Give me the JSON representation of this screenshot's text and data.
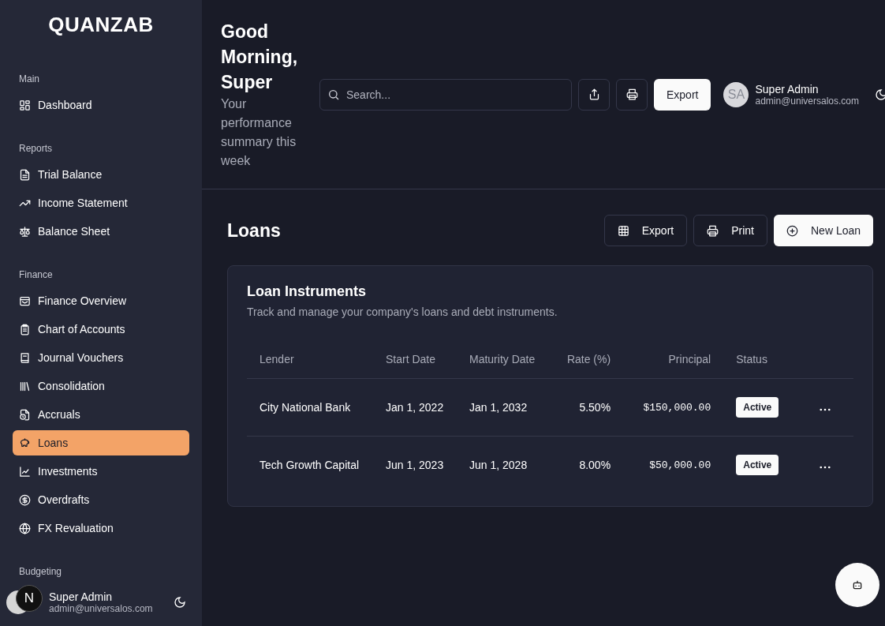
{
  "brand": "QUANZAB",
  "sidebar": {
    "sections": [
      {
        "label": "Main",
        "items": [
          {
            "label": "Dashboard",
            "selected": false
          }
        ]
      },
      {
        "label": "Reports",
        "items": [
          {
            "label": "Trial Balance",
            "selected": false
          },
          {
            "label": "Income Statement",
            "selected": false
          },
          {
            "label": "Balance Sheet",
            "selected": false
          }
        ]
      },
      {
        "label": "Finance",
        "items": [
          {
            "label": "Finance Overview",
            "selected": false
          },
          {
            "label": "Chart of Accounts",
            "selected": false
          },
          {
            "label": "Journal Vouchers",
            "selected": false
          },
          {
            "label": "Consolidation",
            "selected": false
          },
          {
            "label": "Accruals",
            "selected": false
          },
          {
            "label": "Loans",
            "selected": true
          },
          {
            "label": "Investments",
            "selected": false
          },
          {
            "label": "Overdrafts",
            "selected": false
          },
          {
            "label": "FX Revaluation",
            "selected": false
          }
        ]
      },
      {
        "label": "Budgeting"
      }
    ],
    "user": {
      "name": "Super Admin",
      "email": "admin@universalos.com"
    },
    "badge": "N"
  },
  "header": {
    "greeting": "Good Morning, Super",
    "subtitle": "Your performance summary this week",
    "search": {
      "placeholder": "Search..."
    },
    "export_button": "Export",
    "user": {
      "initials": "SA",
      "name": "Super Admin",
      "email": "admin@universalos.com"
    }
  },
  "page": {
    "title": "Loans",
    "actions": [
      {
        "label": "Export",
        "kind": "outline"
      },
      {
        "label": "Print",
        "kind": "outline"
      },
      {
        "label": "New Loan",
        "kind": "primary"
      }
    ]
  },
  "card": {
    "title": "Loan Instruments",
    "description": "Track and manage your company's loans and debt instruments.",
    "columns": [
      "Lender",
      "Start Date",
      "Maturity Date",
      "Rate (%)",
      "Principal",
      "Status"
    ],
    "rows": [
      {
        "lender": "City National Bank",
        "start": "Jan 1, 2022",
        "maturity": "Jan 1, 2032",
        "rate": "5.50%",
        "principal": "$150,000.00",
        "status": "Active"
      },
      {
        "lender": "Tech Growth Capital",
        "start": "Jun 1, 2023",
        "maturity": "Jun 1, 2028",
        "rate": "8.00%",
        "principal": "$50,000.00",
        "status": "Active"
      }
    ]
  }
}
